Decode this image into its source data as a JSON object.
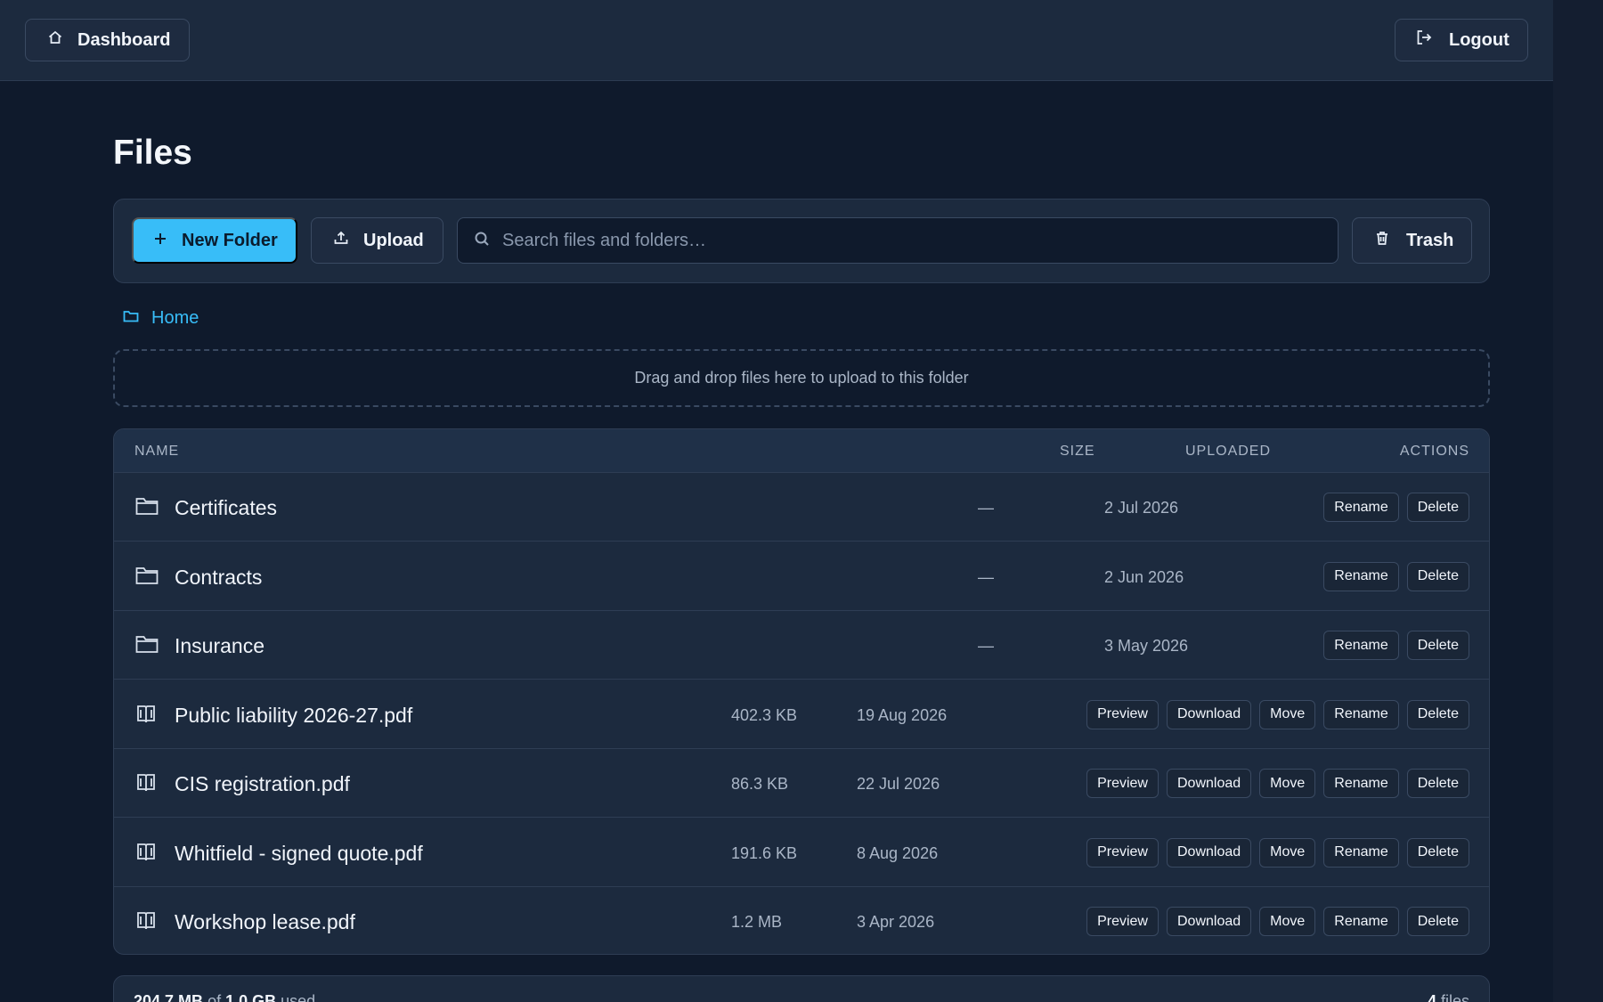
{
  "topbar": {
    "dashboard_label": "Dashboard",
    "logout_label": "Logout"
  },
  "page": {
    "title": "Files"
  },
  "toolbar": {
    "new_folder_label": "New Folder",
    "upload_label": "Upload",
    "search_placeholder": "Search files and folders…",
    "search_value": "",
    "trash_label": "Trash"
  },
  "breadcrumb": {
    "home_label": "Home"
  },
  "dropzone": {
    "text": "Drag and drop files here to upload to this folder"
  },
  "table": {
    "headers": {
      "name": "NAME",
      "size": "SIZE",
      "uploaded": "UPLOADED",
      "actions": "ACTIONS"
    },
    "rows": [
      {
        "type": "folder",
        "icon": "folder-icon",
        "name": "Certificates",
        "size": "—",
        "uploaded": "2 Jul 2026",
        "actions": [
          "Rename",
          "Delete"
        ]
      },
      {
        "type": "folder",
        "icon": "folder-icon",
        "name": "Contracts",
        "size": "—",
        "uploaded": "2 Jun 2026",
        "actions": [
          "Rename",
          "Delete"
        ]
      },
      {
        "type": "folder",
        "icon": "folder-icon",
        "name": "Insurance",
        "size": "—",
        "uploaded": "3 May 2026",
        "actions": [
          "Rename",
          "Delete"
        ]
      },
      {
        "type": "file",
        "icon": "book-icon",
        "name": "Public liability 2026-27.pdf",
        "size": "402.3 KB",
        "uploaded": "19 Aug 2026",
        "actions": [
          "Preview",
          "Download",
          "Move",
          "Rename",
          "Delete"
        ]
      },
      {
        "type": "file",
        "icon": "book-icon",
        "name": "CIS registration.pdf",
        "size": "86.3 KB",
        "uploaded": "22 Jul 2026",
        "actions": [
          "Preview",
          "Download",
          "Move",
          "Rename",
          "Delete"
        ]
      },
      {
        "type": "file",
        "icon": "book-icon",
        "name": "Whitfield - signed quote.pdf",
        "size": "191.6 KB",
        "uploaded": "8 Aug 2026",
        "actions": [
          "Preview",
          "Download",
          "Move",
          "Rename",
          "Delete"
        ]
      },
      {
        "type": "file",
        "icon": "book-icon",
        "name": "Workshop lease.pdf",
        "size": "1.2 MB",
        "uploaded": "3 Apr 2026",
        "actions": [
          "Preview",
          "Download",
          "Move",
          "Rename",
          "Delete"
        ]
      }
    ]
  },
  "footer": {
    "used": "204.7 MB",
    "of_label": "of",
    "total": "1.0 GB",
    "used_label": "used",
    "file_count": "4",
    "files_label": "files"
  },
  "colors": {
    "accent": "#38bdf8",
    "background": "#0f1a2c",
    "panel": "#1c2a3e"
  }
}
